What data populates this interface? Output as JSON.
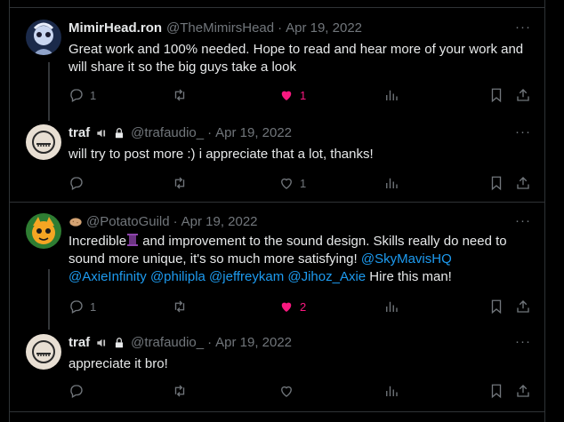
{
  "colors": {
    "accent": "#1d9bf0",
    "like": "#f91880",
    "muted": "#71767b",
    "text": "#e7e9ea",
    "border": "#2f3336"
  },
  "more_label": "···",
  "tweets": [
    {
      "display_name": "MimirHead.ron",
      "handle": "@TheMimirsHead",
      "date": "Apr 19, 2022",
      "text": "Great work and 100% needed. Hope to read and hear more of your work and will share it so the big guys take a look",
      "reply_count": "1",
      "like_count": "1",
      "liked": true
    },
    {
      "display_name": "traf",
      "handle": "@trafaudio_",
      "date": "Apr 19, 2022",
      "text": "will try to post more :) i appreciate that a lot, thanks!",
      "reply_count": "",
      "like_count": "1",
      "liked": false
    },
    {
      "display_name": "",
      "handle": "@PotatoGuild",
      "date": "Apr 19, 2022",
      "text_a": "Incredible",
      "text_b": " and improvement to the sound design. Skills really do need to sound more unique, it's so much more satisfying! ",
      "mentions": [
        "@SkyMavisHQ",
        "@AxieInfinity",
        "@philipla",
        "@jeffreykam",
        "@Jihoz_Axie"
      ],
      "text_end": " Hire this man!",
      "reply_count": "1",
      "like_count": "2",
      "liked": true
    },
    {
      "display_name": "traf",
      "handle": "@trafaudio_",
      "date": "Apr 19, 2022",
      "text": "appreciate it bro!",
      "reply_count": "",
      "like_count": "",
      "liked": false
    }
  ],
  "icons": [
    "reply-icon",
    "retweet-icon",
    "like-icon",
    "views-icon",
    "bookmark-icon",
    "share-icon",
    "speaker-icon",
    "lock-icon"
  ]
}
